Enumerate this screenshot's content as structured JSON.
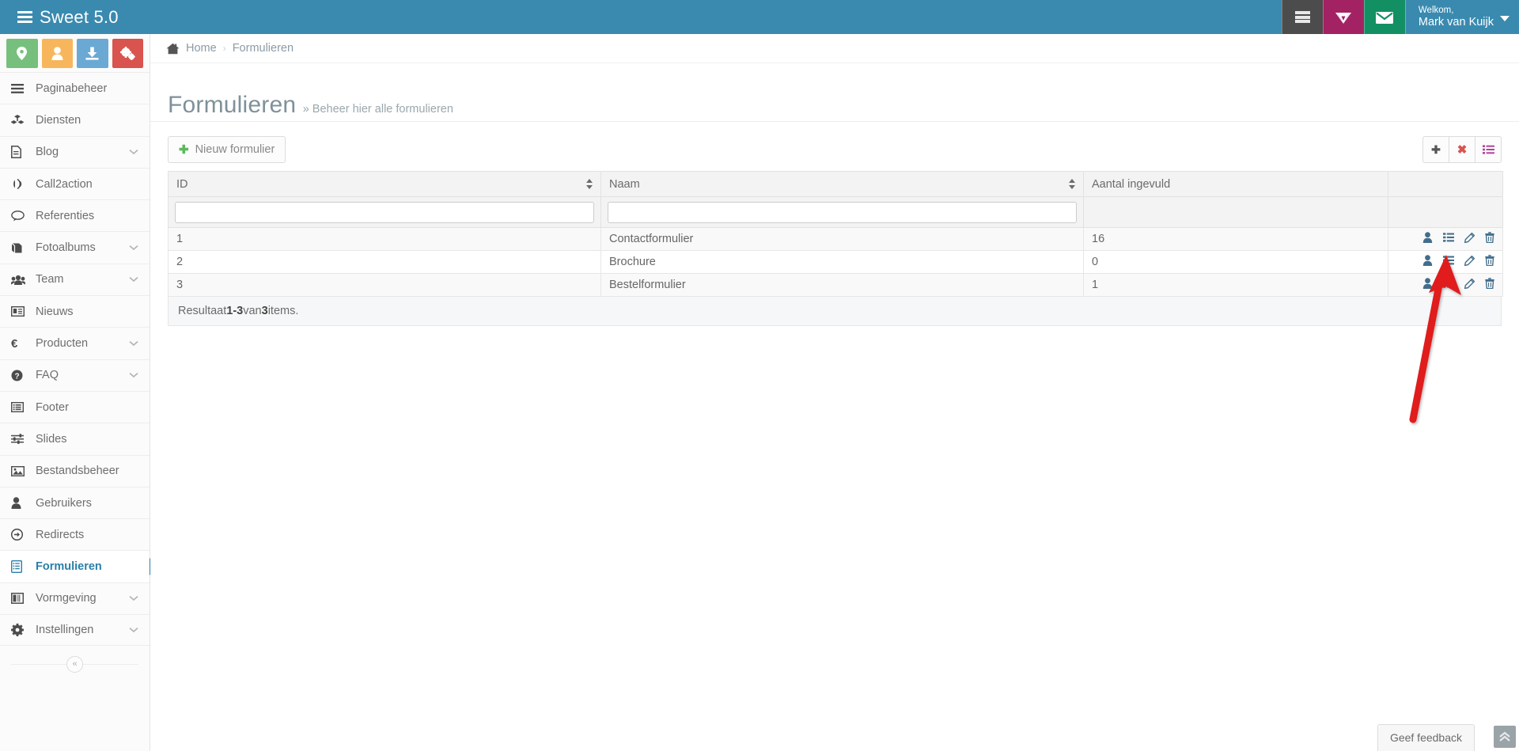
{
  "header": {
    "brand": "Sweet 5.0",
    "brand_icon": "server-stack-icon",
    "buttons": [
      {
        "name": "server-button",
        "icon": "server-stack-icon",
        "color": "#4c4c4c"
      },
      {
        "name": "premium-button",
        "icon": "diamond-shield-icon",
        "color": "#a32263"
      },
      {
        "name": "mail-button",
        "icon": "envelope-icon",
        "color": "#129064"
      }
    ],
    "user": {
      "greeting": "Welkom,",
      "name": "Mark van Kuijk",
      "caret_icon": "caret-down-icon"
    },
    "bar_color": "#3a8ab0"
  },
  "sidebar": {
    "quick_buttons": [
      {
        "name": "locations-quick-button",
        "icon": "map-marker-icon",
        "color": "#77bf7d"
      },
      {
        "name": "users-quick-button",
        "icon": "user-icon",
        "color": "#f7b65c"
      },
      {
        "name": "downloads-quick-button",
        "icon": "download-icon",
        "color": "#6aa9d4"
      },
      {
        "name": "settings-quick-button",
        "icon": "gears-icon",
        "color": "#d9534f"
      }
    ],
    "items": [
      {
        "label": "Paginabeheer",
        "icon": "bars-icon",
        "expandable": false,
        "active": false
      },
      {
        "label": "Diensten",
        "icon": "cubes-icon",
        "expandable": false,
        "active": false
      },
      {
        "label": "Blog",
        "icon": "file-text-icon",
        "expandable": true,
        "active": false
      },
      {
        "label": "Call2action",
        "icon": "bullhorn-icon",
        "expandable": false,
        "active": false
      },
      {
        "label": "Referenties",
        "icon": "comment-icon",
        "expandable": false,
        "active": false
      },
      {
        "label": "Fotoalbums",
        "icon": "book-icon",
        "expandable": true,
        "active": false
      },
      {
        "label": "Team",
        "icon": "group-icon",
        "expandable": true,
        "active": false
      },
      {
        "label": "Nieuws",
        "icon": "newspaper-icon",
        "expandable": false,
        "active": false
      },
      {
        "label": "Producten",
        "icon": "euro-icon",
        "expandable": true,
        "active": false
      },
      {
        "label": "FAQ",
        "icon": "question-circle-icon",
        "expandable": true,
        "active": false
      },
      {
        "label": "Footer",
        "icon": "list-alt-icon",
        "expandable": false,
        "active": false
      },
      {
        "label": "Slides",
        "icon": "sliders-icon",
        "expandable": false,
        "active": false
      },
      {
        "label": "Bestandsbeheer",
        "icon": "image-icon",
        "expandable": false,
        "active": false
      },
      {
        "label": "Gebruikers",
        "icon": "user-icon",
        "expandable": false,
        "active": false
      },
      {
        "label": "Redirects",
        "icon": "arrow-circle-right-icon",
        "expandable": false,
        "active": false
      },
      {
        "label": "Formulieren",
        "icon": "form-list-icon",
        "expandable": false,
        "active": true
      },
      {
        "label": "Vormgeving",
        "icon": "columns-icon",
        "expandable": true,
        "active": false
      },
      {
        "label": "Instellingen",
        "icon": "gear-icon",
        "expandable": true,
        "active": false
      }
    ],
    "collapse_icon": "double-chevron-left-icon",
    "active_color": "#2a7fa8"
  },
  "breadcrumb": {
    "home_icon": "home-icon",
    "home": "Home",
    "separator": "›",
    "current": "Formulieren"
  },
  "page": {
    "title": "Formulieren",
    "subtitle": "» Beheer hier alle formulieren"
  },
  "toolbar": {
    "new_label": "Nieuw formulier",
    "new_icon": "plus-icon",
    "right_buttons": [
      {
        "name": "add-column-button",
        "icon": "plus-icon",
        "color": "#555555"
      },
      {
        "name": "clear-filters-button",
        "icon": "times-icon",
        "color": "#d9534f"
      },
      {
        "name": "column-chooser-button",
        "icon": "list-ul-icon",
        "color": "#b0439b"
      }
    ]
  },
  "table": {
    "columns": [
      {
        "label": "ID",
        "sortable": true
      },
      {
        "label": "Naam",
        "sortable": true
      },
      {
        "label": "Aantal ingevuld",
        "sortable": false
      },
      {
        "label": "",
        "sortable": false
      }
    ],
    "filters": [
      {
        "name": "filter-id",
        "value": "",
        "placeholder": ""
      },
      {
        "name": "filter-naam",
        "value": "",
        "placeholder": ""
      }
    ],
    "rows": [
      {
        "id": "1",
        "naam": "Contactformulier",
        "aantal": "16"
      },
      {
        "id": "2",
        "naam": "Brochure",
        "aantal": "0"
      },
      {
        "id": "3",
        "naam": "Bestelformulier",
        "aantal": "1"
      }
    ],
    "row_actions": [
      {
        "name": "row-action-submissions-user",
        "icon": "user-icon"
      },
      {
        "name": "row-action-entries-list",
        "icon": "list-icon"
      },
      {
        "name": "row-action-edit",
        "icon": "pencil-icon"
      },
      {
        "name": "row-action-delete",
        "icon": "trash-icon"
      }
    ],
    "footer": {
      "prefix": "Resultaat ",
      "range": "1-3",
      "middle": " van ",
      "total": "3",
      "suffix": " items."
    }
  },
  "overlays": {
    "feedback_label": "Geef feedback",
    "scroll_top_icon": "double-chevron-up-icon",
    "annotation": {
      "name": "red-arrow-annotation",
      "color": "#e01b1b",
      "points_to": "row-action-entries-list"
    }
  }
}
